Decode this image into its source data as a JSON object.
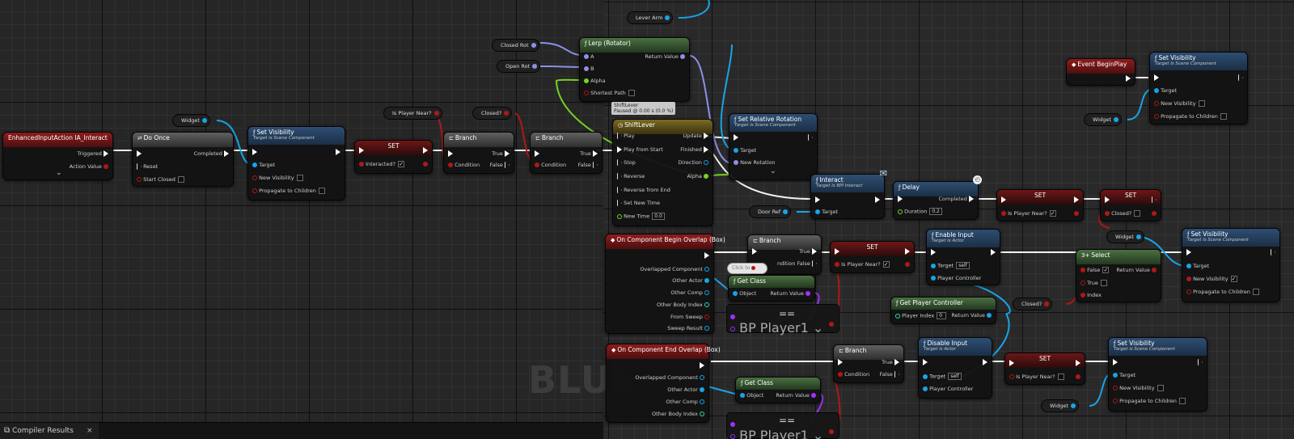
{
  "tabs": {
    "compiler_results": "Compiler Results",
    "close_glyph": "×"
  },
  "watermark": "BLUE",
  "nodes": {
    "enhanced_input": {
      "title": "EnhancedInputAction IA_Interact",
      "triggered": "Triggered",
      "action_value": "Action Value",
      "expand": "⌄"
    },
    "do_once": {
      "title": "Do Once",
      "completed": "Completed",
      "reset": "Reset",
      "start_closed": "Start Closed"
    },
    "widget_getter_1": "Widget",
    "set_visibility_1": {
      "title": "Set Visibility",
      "subtitle": "Target is Scene Component",
      "target": "Target",
      "new_visibility": "New Visibility",
      "propagate": "Propagate to Children"
    },
    "set_interacted": {
      "title": "SET",
      "pin": "Interacted?"
    },
    "is_player_near_getter": "Is Player Near?",
    "branch_1": {
      "title": "Branch",
      "condition": "Condition",
      "true": "True",
      "false": "False"
    },
    "closed_getter_1": "Closed?",
    "branch_2": {
      "title": "Branch",
      "condition": "Condition",
      "true": "True",
      "false": "False"
    },
    "closed_rot": "Closed Rot",
    "open_rot": "Open Rot",
    "lever_arm": "Lever Arm",
    "lerp": {
      "title": "Lerp (Rotator)",
      "a": "A",
      "b": "B",
      "alpha": "Alpha",
      "shortest_path": "Shortest Path",
      "return_value": "Return Value"
    },
    "timeline": {
      "title": "ShiftLever",
      "tooltip_1": "ShiftLever",
      "tooltip_2": "Paused @ 0.00 s (0.0 %)",
      "play": "Play",
      "play_from_start": "Play from Start",
      "stop": "Stop",
      "reverse": "Reverse",
      "reverse_from_end": "Reverse from End",
      "set_new_time": "Set New Time",
      "new_time": "New Time",
      "new_time_value": "0.0",
      "update": "Update",
      "finished": "Finished",
      "direction": "Direction",
      "alpha": "Alpha"
    },
    "set_relative_rotation": {
      "title": "Set Relative Rotation",
      "subtitle": "Target is Scene Component",
      "target": "Target",
      "new_rotation": "New Rotation",
      "expand": "⌄"
    },
    "interact": {
      "title": "Interact",
      "subtitle": "Target is BPI Interact",
      "target": "Target"
    },
    "door_ref": "Door Ref",
    "delay": {
      "title": "Delay",
      "completed": "Completed",
      "duration": "Duration",
      "duration_value": "0.2"
    },
    "set_is_player_near_1": {
      "title": "SET",
      "pin": "Is Player Near?"
    },
    "set_closed": {
      "title": "SET",
      "pin": "Closed?"
    },
    "event_begin_play": {
      "title": "Event BeginPlay"
    },
    "set_visibility_2": {
      "title": "Set Visibility",
      "subtitle": "Target is Scene Component",
      "target": "Target",
      "new_visibility": "New Visibility",
      "propagate": "Propagate to Children"
    },
    "widget_getter_2": "Widget",
    "begin_overlap": {
      "title": "On Component Begin Overlap (Box)",
      "overlapped": "Overlapped Component",
      "other_actor": "Other Actor",
      "other_comp": "Other Comp",
      "other_body": "Other Body Index",
      "from_sweep": "From Sweep",
      "sweep_result": "Sweep Result"
    },
    "branch_3": {
      "title": "Branch",
      "true": "True",
      "false": "False",
      "click_tip": "Click to",
      "condition_fragment": "ndition"
    },
    "set_is_player_near_2": {
      "title": "SET",
      "pin": "Is Player Near?"
    },
    "enable_input": {
      "title": "Enable Input",
      "subtitle": "Target is Actor",
      "target": "Target",
      "target_value": "self",
      "player_controller": "Player Controller"
    },
    "select": {
      "title": "Select",
      "false": "False",
      "true": "True",
      "index": "Index",
      "return_value": "Return Value"
    },
    "widget_getter_3": "Widget",
    "set_visibility_3": {
      "title": "Set Visibility",
      "subtitle": "Target is Scene Component",
      "target": "Target",
      "new_visibility": "New Visibility",
      "propagate": "Propagate to Children"
    },
    "get_class_1": {
      "title": "Get Class",
      "object": "Object",
      "return_value": "Return Value"
    },
    "equal_1": {
      "label": "BP Player1 ⌄",
      "op": "=="
    },
    "get_player_controller": {
      "title": "Get Player Controller",
      "player_index": "Player Index",
      "player_index_value": "0",
      "return_value": "Return Value"
    },
    "closed_getter_2": "Closed?",
    "end_overlap": {
      "title": "On Component End Overlap (Box)",
      "overlapped": "Overlapped Component",
      "other_actor": "Other Actor",
      "other_comp": "Other Comp",
      "other_body": "Other Body Index"
    },
    "branch_4": {
      "title": "Branch",
      "condition": "Condition",
      "true": "True",
      "false": "False"
    },
    "disable_input": {
      "title": "Disable Input",
      "subtitle": "Target is Actor",
      "target": "Target",
      "target_value": "self",
      "player_controller": "Player Controller"
    },
    "set_is_player_near_3": {
      "title": "SET",
      "pin": "Is Player Near?"
    },
    "set_visibility_4": {
      "title": "Set Visibility",
      "subtitle": "Target is Scene Component",
      "target": "Target",
      "new_visibility": "New Visibility",
      "propagate": "Propagate to Children"
    },
    "get_class_2": {
      "title": "Get Class",
      "object": "Object",
      "return_value": "Return Value"
    },
    "equal_2": {
      "label": "BP Player1 ⌄",
      "op": "=="
    },
    "widget_getter_4": "Widget"
  },
  "colors": {
    "exec": "#ffffff",
    "object": "#18a4e6",
    "bool": "#b01818",
    "float": "#76d224",
    "rotator": "#8f8fe8",
    "class": "#a030ff"
  }
}
